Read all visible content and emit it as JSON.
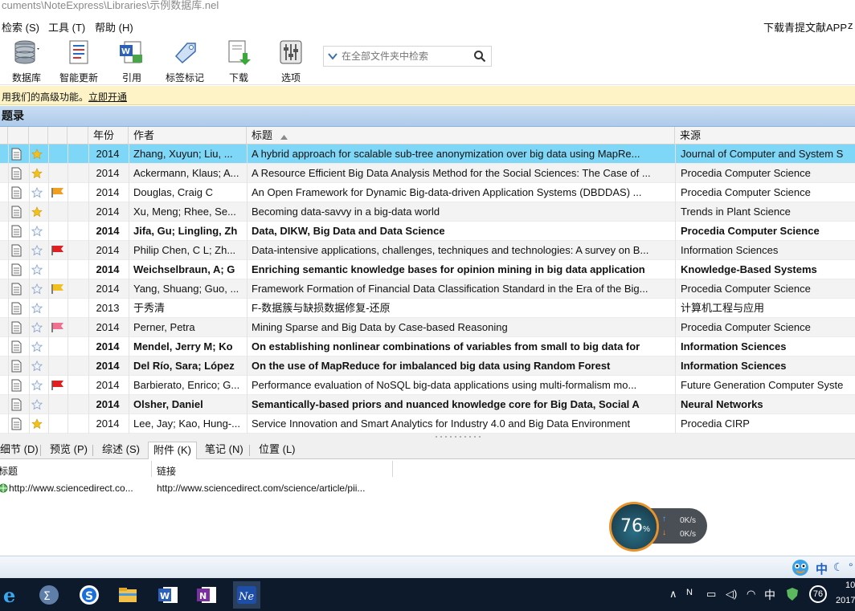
{
  "window": {
    "title": "cuments\\NoteExpress\\Libraries\\示例数据库.nel"
  },
  "menu": {
    "items": [
      "检索 (S)",
      "工具 (T)",
      "帮助 (H)"
    ],
    "right_link": "下载青提文献APP",
    "right_edge": "z"
  },
  "toolbar": {
    "database": "数据库",
    "smart_update": "智能更新",
    "cite": "引用",
    "tag": "标签标记",
    "download": "下载",
    "options": "选项",
    "search_placeholder": "在全部文件夹中检索"
  },
  "promo": {
    "text": "用我们的高级功能。",
    "link": "立即开通"
  },
  "section": {
    "title": "题录"
  },
  "columns": {
    "year": "年份",
    "author": "作者",
    "title": "标题",
    "source": "来源"
  },
  "rows": [
    {
      "year": "2014",
      "author": "Zhang, Xuyun; Liu, ...",
      "title": "A hybrid approach for scalable sub-tree anonymization over big data using MapRe...",
      "source": "Journal of Computer and System S",
      "star": true,
      "flag": "",
      "selected": true,
      "bold": false
    },
    {
      "year": "2014",
      "author": "Ackermann, Klaus; A...",
      "title": "A Resource Efficient Big Data Analysis Method for the Social Sciences: The Case of ...",
      "source": "Procedia Computer Science",
      "star": true,
      "flag": "",
      "selected": false,
      "bold": false
    },
    {
      "year": "2014",
      "author": "Douglas, Craig C",
      "title": "An Open Framework for Dynamic Big-data-driven Application Systems (DBDDAS) ...",
      "source": "Procedia Computer Science",
      "star": false,
      "flag": "#f0a020",
      "selected": false,
      "bold": false
    },
    {
      "year": "2014",
      "author": "Xu, Meng; Rhee, Se...",
      "title": "Becoming data-savvy in a big-data world",
      "source": "Trends in Plant Science",
      "star": true,
      "flag": "",
      "selected": false,
      "bold": false
    },
    {
      "year": "2014",
      "author": "Jifa, Gu; Lingling, Zh",
      "title": "Data, DIKW, Big Data and Data Science",
      "source": "Procedia Computer Science",
      "star": false,
      "flag": "",
      "selected": false,
      "bold": true
    },
    {
      "year": "2014",
      "author": "Philip Chen, C L; Zh...",
      "title": "Data-intensive applications, challenges, techniques and technologies: A survey on B...",
      "source": "Information Sciences",
      "star": false,
      "flag": "#e02020",
      "selected": false,
      "bold": false
    },
    {
      "year": "2014",
      "author": "Weichselbraun, A; G",
      "title": "Enriching semantic knowledge bases for opinion mining in big data application",
      "source": "Knowledge-Based Systems",
      "star": false,
      "flag": "",
      "selected": false,
      "bold": true
    },
    {
      "year": "2014",
      "author": "Yang, Shuang; Guo, ...",
      "title": "Framework Formation of Financial Data Classification Standard in the Era of the Big...",
      "source": "Procedia Computer Science",
      "star": false,
      "flag": "#f0c020",
      "selected": false,
      "bold": false
    },
    {
      "year": "2013",
      "author": "于秀清",
      "title": "F-数据簇与缺损数据修复-还原",
      "source": "计算机工程与应用",
      "star": false,
      "flag": "",
      "selected": false,
      "bold": false
    },
    {
      "year": "2014",
      "author": "Perner, Petra",
      "title": "Mining Sparse and Big Data by Case-based Reasoning",
      "source": "Procedia Computer Science",
      "star": false,
      "flag": "#f07090",
      "selected": false,
      "bold": false
    },
    {
      "year": "2014",
      "author": "Mendel, Jerry M; Ko",
      "title": "On establishing nonlinear combinations of variables from small to big data for",
      "source": "Information Sciences",
      "star": false,
      "flag": "",
      "selected": false,
      "bold": true
    },
    {
      "year": "2014",
      "author": "Del Río, Sara; López",
      "title": "On the use of MapReduce for imbalanced big data using Random Forest",
      "source": "Information Sciences",
      "star": false,
      "flag": "",
      "selected": false,
      "bold": true
    },
    {
      "year": "2014",
      "author": "Barbierato, Enrico; G...",
      "title": "Performance evaluation of NoSQL big-data applications using multi-formalism mo...",
      "source": "Future Generation Computer Syste",
      "star": false,
      "flag": "#e02020",
      "selected": false,
      "bold": false
    },
    {
      "year": "2014",
      "author": "Olsher, Daniel",
      "title": "Semantically-based priors and nuanced knowledge core for Big Data, Social A",
      "source": "Neural Networks",
      "star": false,
      "flag": "",
      "selected": false,
      "bold": true
    },
    {
      "year": "2014",
      "author": "Lee, Jay; Kao, Hung-...",
      "title": "Service Innovation and Smart Analytics for Industry 4.0 and Big Data Environment",
      "source": "Procedia CIRP",
      "star": true,
      "flag": "",
      "selected": false,
      "bold": false
    }
  ],
  "tabs": [
    "细节 (D)",
    "预览 (P)",
    "综述 (S)",
    "附件 (K)",
    "笔记 (N)",
    "位置 (L)"
  ],
  "detail": {
    "col_title": "标题",
    "col_link": "链接",
    "row_title": "http://www.sciencedirect.co...",
    "row_link": "http://www.sciencedirect.com/science/article/pii..."
  },
  "speed": {
    "percent": "76",
    "percent_sign": "%",
    "up": "0K/s",
    "down": "0K/s"
  },
  "status": {
    "ime": "中"
  },
  "taskbar": {
    "ime": "中",
    "badge": "76",
    "clock_top": "10",
    "clock_bottom": "2017"
  }
}
